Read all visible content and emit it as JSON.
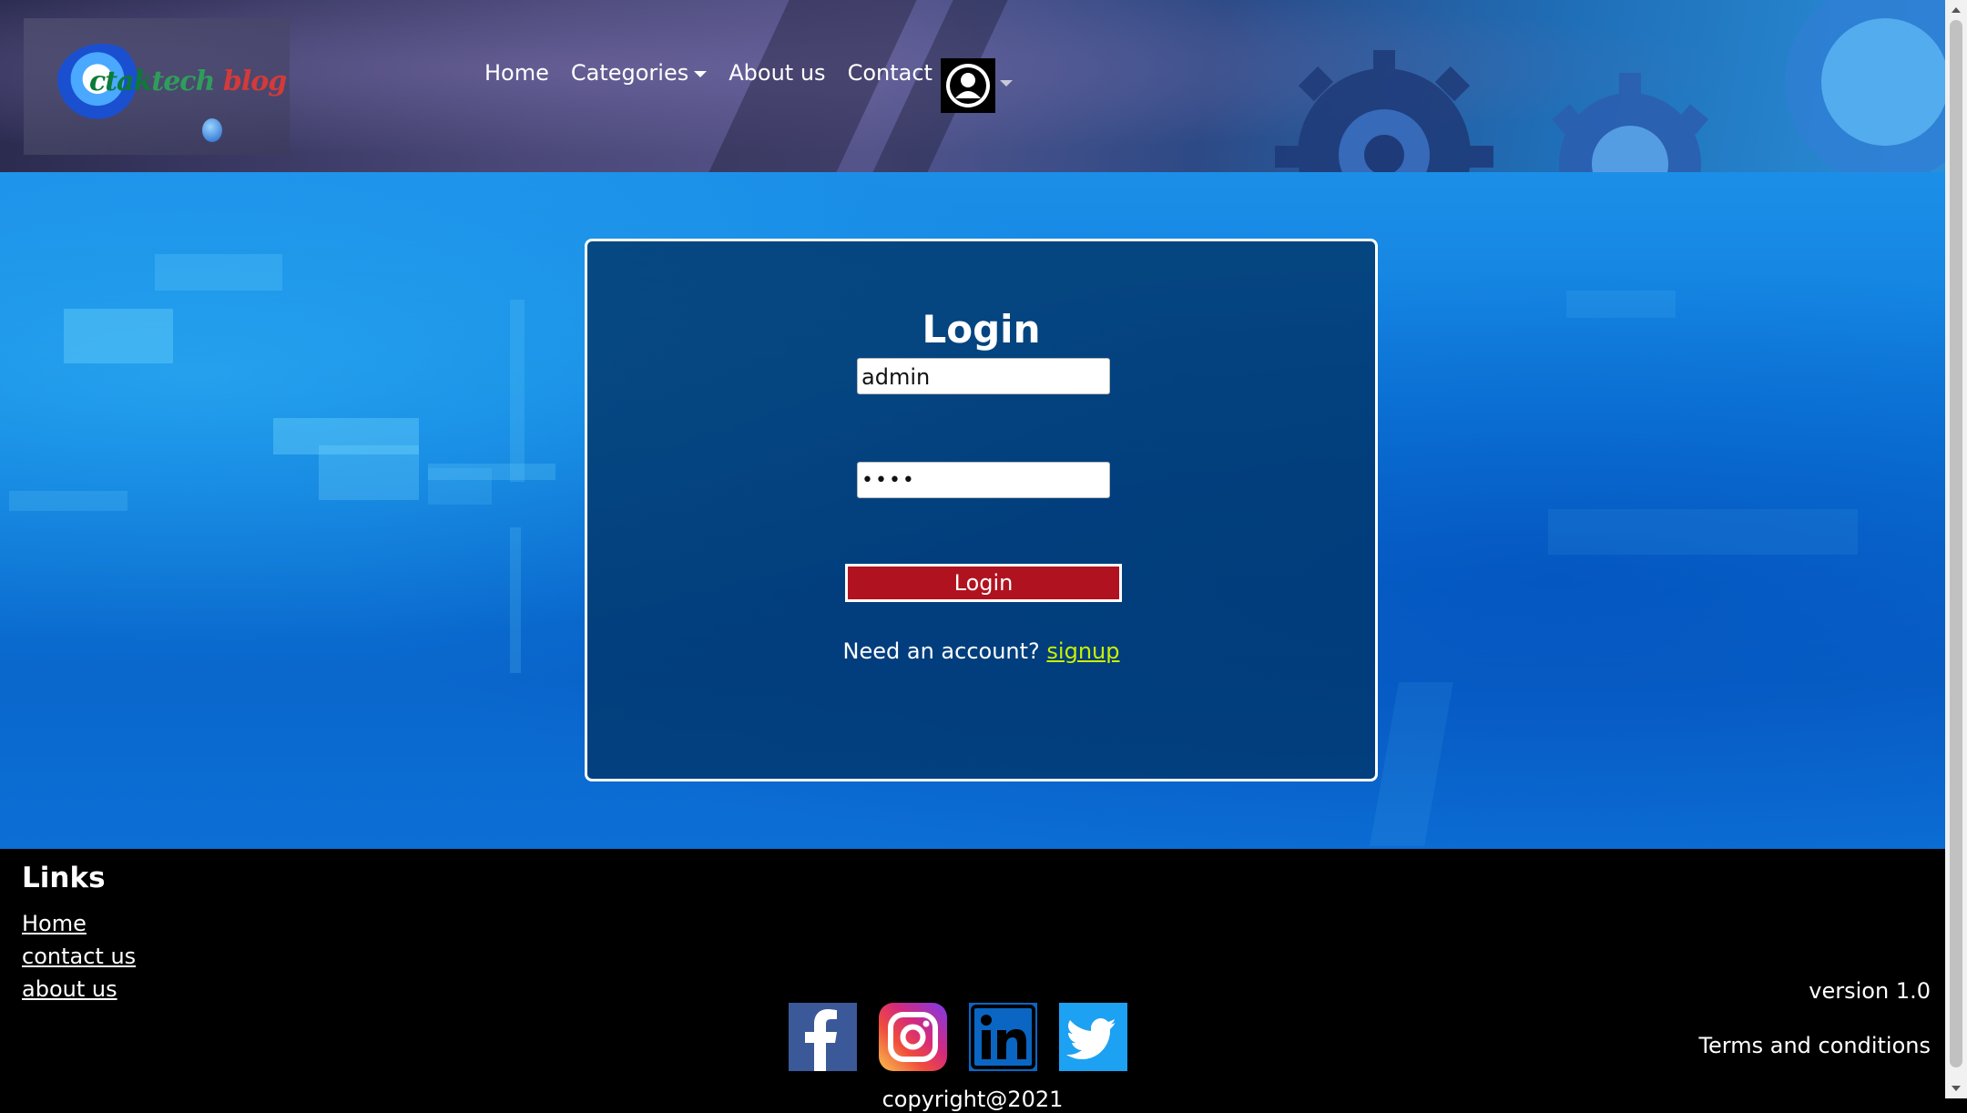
{
  "header": {
    "logo": {
      "text_a": "ctak",
      "text_b": "tech",
      "text_c": "blog",
      "icon": "logo-icon"
    },
    "nav": {
      "home": "Home",
      "categories": "Categories",
      "about": "About us",
      "contact": "Contact us"
    },
    "profile_icon": "user-avatar-icon"
  },
  "login": {
    "title": "Login",
    "username_value": "admin",
    "password_value": "••••",
    "button_label": "Login",
    "need_account": "Need an account?",
    "signup_label": "signup"
  },
  "footer": {
    "links_title": "Links",
    "links": [
      "Home",
      "contact us",
      "about us"
    ],
    "socials": [
      "facebook-icon",
      "instagram-icon",
      "linkedin-icon",
      "twitter-icon"
    ],
    "version": "version 1.0",
    "terms": "Terms and conditions",
    "copyright": "copyright@2021"
  },
  "colors": {
    "login_button": "#b1121f",
    "signup_link": "#c8f000",
    "footer_bg": "#000000"
  }
}
